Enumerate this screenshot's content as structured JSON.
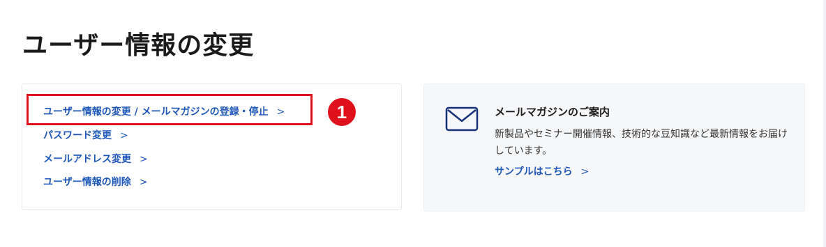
{
  "page": {
    "title": "ユーザー情報の変更"
  },
  "links": [
    {
      "label": "ユーザー情報の変更 / メールマガジンの登録・停止",
      "chevron": ">"
    },
    {
      "label": "パスワード変更",
      "chevron": ">"
    },
    {
      "label": "メールアドレス変更",
      "chevron": ">"
    },
    {
      "label": "ユーザー情報の削除",
      "chevron": ">"
    }
  ],
  "annotation": {
    "step": "1",
    "color": "#e0111a"
  },
  "magazine": {
    "icon": "mail-icon",
    "title": "メールマガジンのご案内",
    "description": "新製品やセミナー開催情報、技術的な豆知識など最新情報をお届けしています。",
    "link_label": "サンプルはこちら",
    "chevron": ">"
  },
  "colors": {
    "link": "#1d57b8",
    "icon": "#14327a",
    "highlight": "#e0111a"
  }
}
